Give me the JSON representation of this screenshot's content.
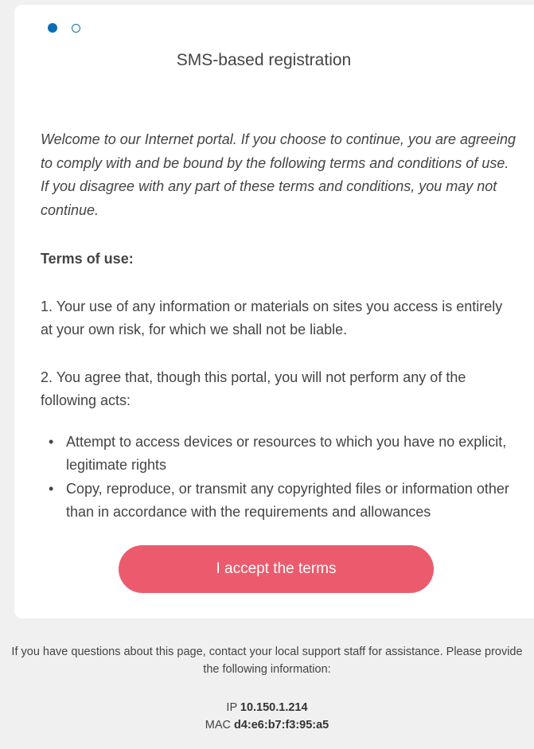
{
  "pager": {
    "active_index": 0,
    "count": 2
  },
  "title": "SMS-based registration",
  "welcome_text": "Welcome to our Internet portal. If you choose to continue, you are agreeing to comply with and be bound by the following terms and conditions of use. If you disagree with any part of these terms and conditions, you may not continue.",
  "terms_heading": "Terms of use:",
  "term_1": "1. Your use of any information or materials on sites you access is entirely at your own risk, for which we shall not be liable.",
  "term_2": "2. You agree that, though this portal, you will not perform any of the following acts:",
  "acts": [
    "Attempt to access devices or resources to which you have no explicit, legitimate rights",
    "Copy, reproduce, or transmit any copyrighted files or information other than in accordance with the requirements and allowances"
  ],
  "accept_button": "I accept the terms",
  "footer": {
    "help_text": "If you have questions about this page, contact your local support staff for assistance. Please provide the following information:",
    "ip_label": "IP",
    "ip_value": "10.150.1.214",
    "mac_label": "MAC",
    "mac_value": "d4:e6:b7:f3:95:a5"
  },
  "colors": {
    "accent": "#0a6fb5",
    "button": "#ec5b6d"
  }
}
